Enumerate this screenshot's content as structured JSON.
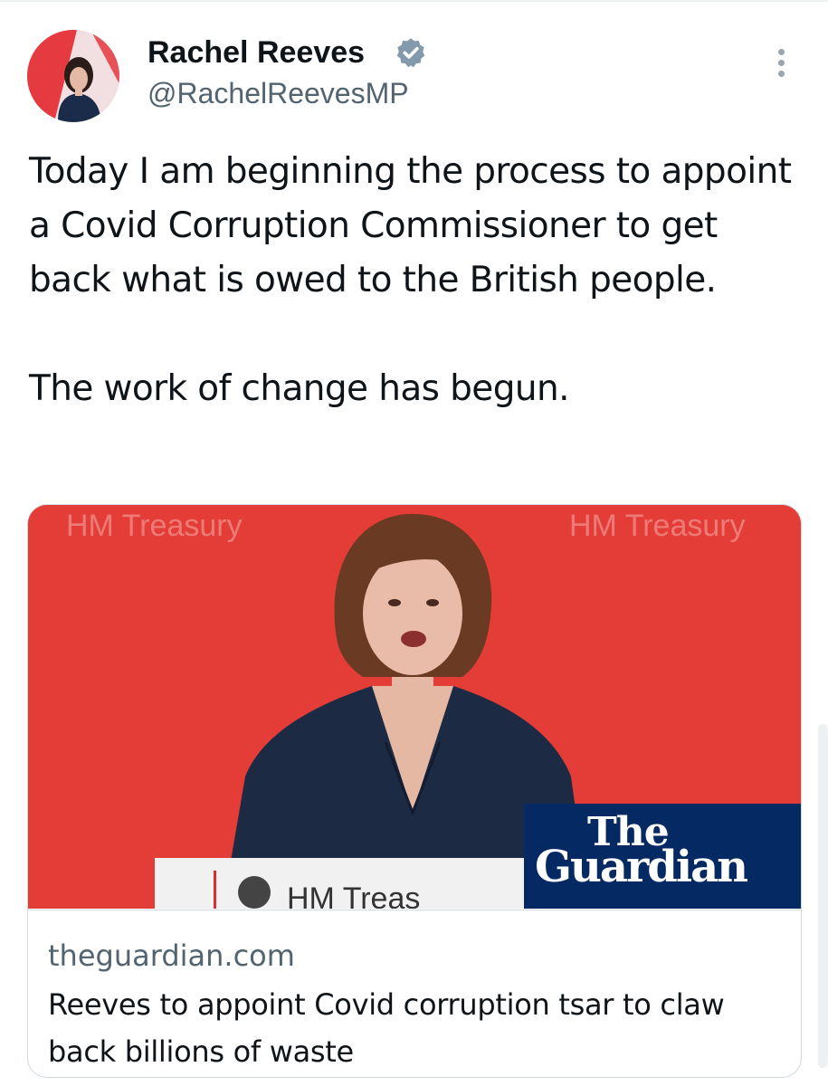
{
  "tweet": {
    "author_name": "Rachel Reeves",
    "handle": "@RachelReevesMP",
    "text_paragraph_1": "Today I am beginning the process to appoint a Covid Corruption Commissioner to get back what is owed to the British people.",
    "text_paragraph_2": "The work of change has begun.",
    "verified_color": "#829aab"
  },
  "card": {
    "domain": "theguardian.com",
    "headline": "Reeves to appoint Covid corruption tsar to claw back billions of waste",
    "image": {
      "watermark_left": "HM Treasury",
      "watermark_right": "HM Treasury",
      "podium_text": "HM Treas",
      "badge_line1": "The",
      "badge_line2": "Guardian",
      "background_color": "#e8403a",
      "badge_color": "#052962"
    }
  },
  "icons": [
    "verified-badge-icon",
    "more-options-icon"
  ]
}
